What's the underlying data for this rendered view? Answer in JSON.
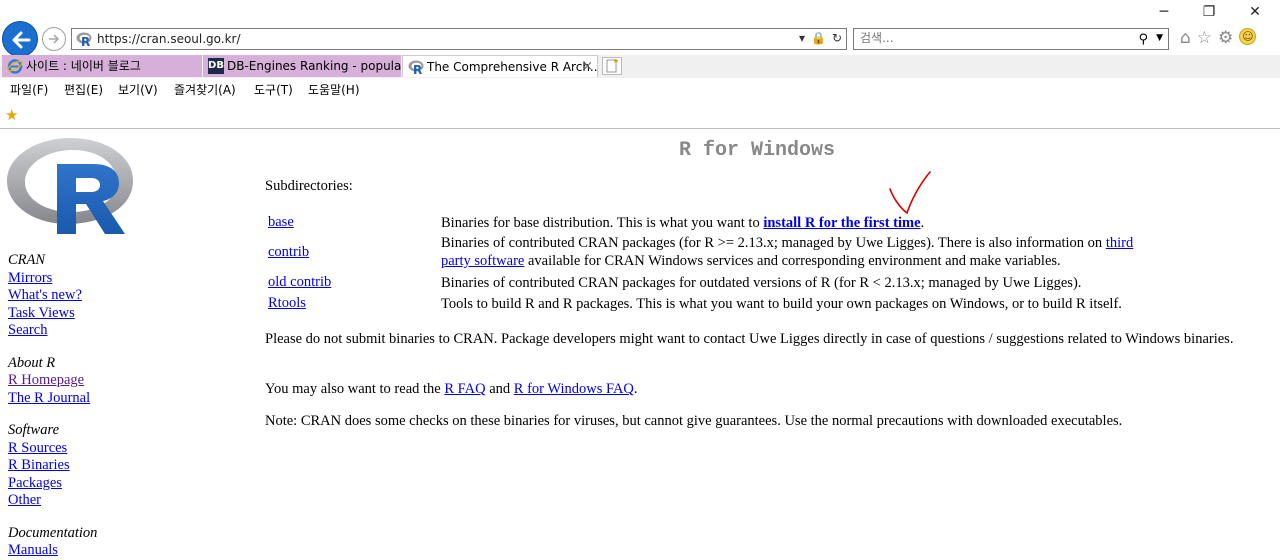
{
  "browser": {
    "url": "https://cran.seoul.go.kr/",
    "search_placeholder": "검색...",
    "tabs": [
      {
        "label": "사이트 : 네이버 블로그"
      },
      {
        "label": "DB-Engines Ranking - popular...",
        "icon_text": "DB"
      },
      {
        "label": "The Comprehensive R Arch...",
        "close": "×"
      }
    ],
    "menu": [
      "파일(F)",
      "편집(E)",
      "보기(V)",
      "즐겨찾기(A)",
      "도구(T)",
      "도움말(H)"
    ],
    "window_controls": {
      "minimize": "─",
      "restore": "❐",
      "close": "✕"
    }
  },
  "sidebar": {
    "sections": [
      {
        "heading": "CRAN",
        "links": [
          "Mirrors",
          "What's new?",
          "Task Views",
          "Search"
        ]
      },
      {
        "heading": "About R",
        "links": [
          "R Homepage",
          "The R Journal"
        ]
      },
      {
        "heading": "Software",
        "links": [
          "R Sources",
          "R Binaries",
          "Packages",
          "Other"
        ]
      },
      {
        "heading": "Documentation",
        "links": [
          "Manuals"
        ]
      }
    ]
  },
  "main": {
    "title": "R for Windows",
    "subdirs_label": "Subdirectories:",
    "rows": [
      {
        "link": "base",
        "pre": "Binaries for base distribution. This is what you want to ",
        "bold_link": "install R for the first time",
        "post": "."
      },
      {
        "link": "contrib",
        "pre": "Binaries of contributed CRAN packages (for R >= 2.13.x; managed by Uwe Ligges). There is also information on ",
        "link1": "third",
        "link2": "party software",
        "post": " available for CRAN Windows services and corresponding environment and make variables."
      },
      {
        "link": "old contrib",
        "text": "Binaries of contributed CRAN packages for outdated versions of R (for R < 2.13.x; managed by Uwe Ligges)."
      },
      {
        "link": "Rtools",
        "text": "Tools to build R and R packages. This is what you want to build your own packages on Windows, or to build R itself."
      }
    ],
    "para1": "Please do not submit binaries to CRAN. Package developers might want to contact Uwe Ligges directly in case of questions / suggestions related to Windows binaries.",
    "para2": {
      "pre": "You may also want to read the ",
      "link1": "R FAQ",
      "mid": " and ",
      "link2": "R for Windows FAQ",
      "post": "."
    },
    "para3": "Note: CRAN does some checks on these binaries for viruses, but cannot give guarantees. Use the normal precautions with downloaded executables."
  },
  "colors": {
    "link": "#0000ee",
    "visited": "#551a8b",
    "title": "#888888",
    "annotation": "#e00000"
  },
  "icons": [
    "back-arrow-icon",
    "forward-arrow-icon",
    "r-favicon-icon",
    "lock-icon",
    "refresh-icon",
    "search-icon",
    "home-icon",
    "star-icon",
    "gear-icon",
    "smiley-icon",
    "new-tab-icon",
    "favorites-add-icon"
  ]
}
